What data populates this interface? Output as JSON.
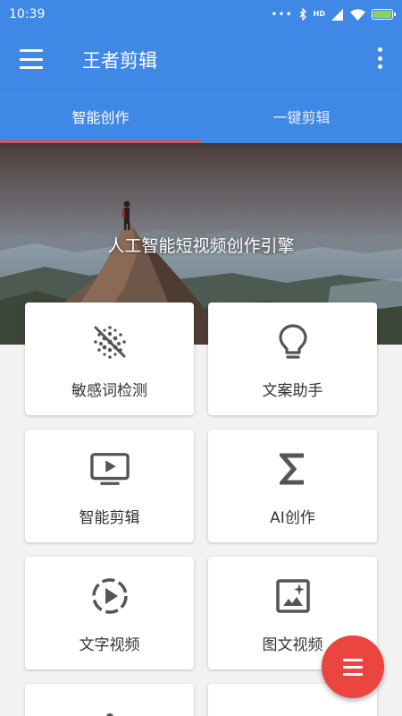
{
  "status_bar": {
    "time": "10:39",
    "network": "HD"
  },
  "app_bar": {
    "title": "王者剪辑"
  },
  "tabs": [
    {
      "label": "智能创作",
      "active": true
    },
    {
      "label": "一键剪辑",
      "active": false
    }
  ],
  "banner": {
    "text": "人工智能短视频创作引擎"
  },
  "features": [
    {
      "label": "敏感词检测",
      "icon": "sensitive-word-icon"
    },
    {
      "label": "文案助手",
      "icon": "lightbulb-icon"
    },
    {
      "label": "智能剪辑",
      "icon": "tv-play-icon"
    },
    {
      "label": "AI创作",
      "icon": "sigma-icon"
    },
    {
      "label": "文字视频",
      "icon": "dashed-play-circle-icon"
    },
    {
      "label": "图文视频",
      "icon": "image-sparkle-icon"
    }
  ],
  "colors": {
    "primary": "#3f88e5",
    "accent": "#e84a45",
    "fab": "#eb4540"
  }
}
